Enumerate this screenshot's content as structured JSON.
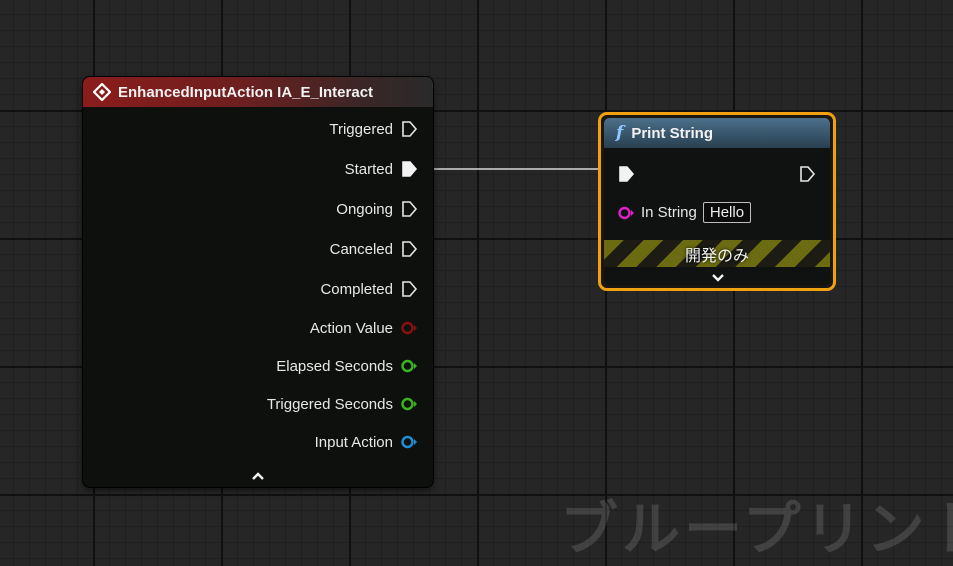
{
  "watermark": "ブループリント",
  "event_node": {
    "title": "EnhancedInputAction IA_E_Interact",
    "header_color": "#8b1c1c",
    "icon": "event-diamond-icon",
    "exec_pins": [
      {
        "label": "Triggered",
        "connected": false
      },
      {
        "label": "Started",
        "connected": true
      },
      {
        "label": "Ongoing",
        "connected": false
      },
      {
        "label": "Canceled",
        "connected": false
      },
      {
        "label": "Completed",
        "connected": false
      }
    ],
    "data_pins": [
      {
        "label": "Action Value",
        "color": "#8a0f0f"
      },
      {
        "label": "Elapsed Seconds",
        "color": "#39b81d"
      },
      {
        "label": "Triggered Seconds",
        "color": "#39b81d"
      },
      {
        "label": "Input Action",
        "color": "#1e8fd6"
      }
    ],
    "collapse_icon": "chevron-up-icon"
  },
  "print_node": {
    "title": "Print String",
    "icon": "function-icon",
    "icon_glyph": "f",
    "header_color": "#4d6f8a",
    "selected_outline_color": "#f0a10d",
    "in_string": {
      "label": "In String",
      "value": "Hello",
      "pin_color": "#e020c8"
    },
    "dev_only_label": "開発のみ",
    "expand_icon": "chevron-down-icon"
  },
  "wire": {
    "from": "Started",
    "to": "Print String exec",
    "color": "#dcdcdc"
  }
}
